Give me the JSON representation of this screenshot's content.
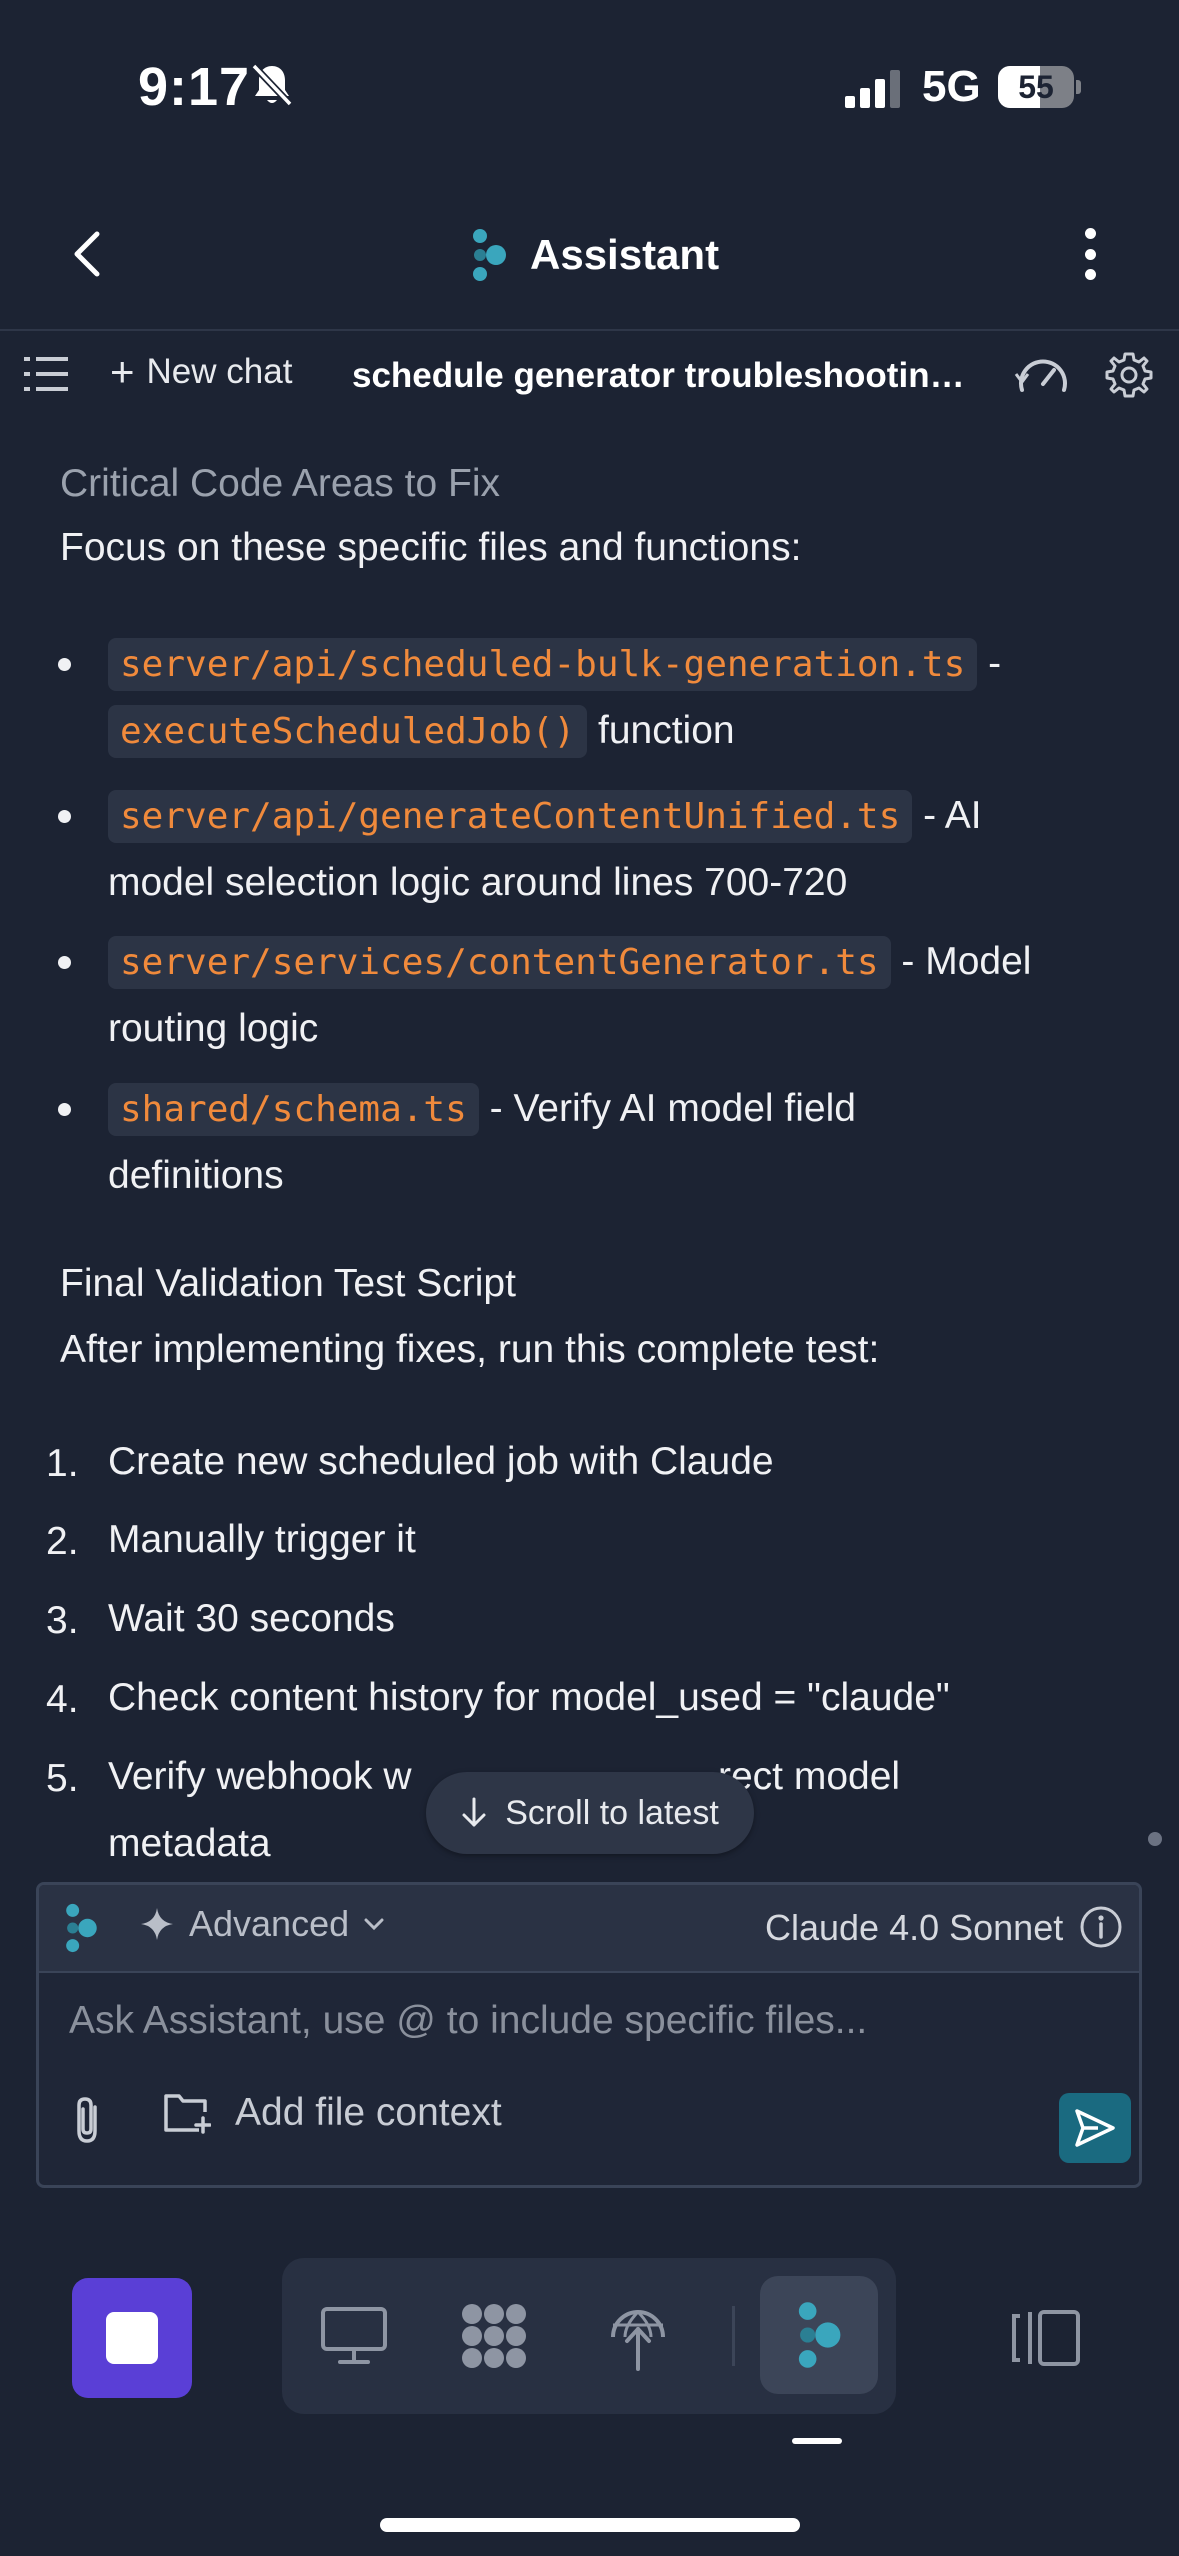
{
  "status_bar": {
    "time": "9:17",
    "network": "5G",
    "battery_percent": "55",
    "battery_level": 0.55
  },
  "header": {
    "title": "Assistant"
  },
  "toolbar": {
    "new_chat_label": "New chat",
    "chat_title": "schedule generator troubleshooting ..."
  },
  "content": {
    "section1_heading": "Critical Code Areas to Fix",
    "section1_intro": "Focus on these specific files and functions:",
    "bullets": [
      {
        "code": "server/api/scheduled-bulk-generation.ts",
        "text_after": " -",
        "code2": "executeScheduledJob()",
        "text2": " function"
      },
      {
        "code": "server/api/generateContentUnified.ts",
        "text_after": " - AI",
        "line2": "model selection logic around lines 700-720"
      },
      {
        "code": "server/services/contentGenerator.ts",
        "text_after": " - Model",
        "line2": "routing logic"
      },
      {
        "code": "shared/schema.ts",
        "text_after": " - Verify AI model field",
        "line2": "definitions"
      }
    ],
    "section2_heading": "Final Validation Test Script",
    "section2_intro": "After implementing fixes, run this complete test:",
    "steps": [
      {
        "num": "1.",
        "text": "Create new scheduled job with Claude"
      },
      {
        "num": "2.",
        "text": "Manually trigger it"
      },
      {
        "num": "3.",
        "text": "Wait 30 seconds"
      },
      {
        "num": "4.",
        "text": "Check content history for model_used = \"claude\""
      },
      {
        "num": "5.",
        "text": "Verify webhook w",
        "text_hidden_right": "rect model",
        "line2": "metadata"
      }
    ]
  },
  "scroll_to_latest_label": "Scroll to latest",
  "input_panel": {
    "mode_label": "Advanced",
    "model_label": "Claude 4.0 Sonnet",
    "placeholder": "Ask Assistant, use @ to include specific files...",
    "add_context_label": "Add file context"
  },
  "colors": {
    "background": "#1c2333",
    "code_text": "#f08a3c",
    "accent_stop": "#5a3fd6",
    "send_button": "#1a6a80"
  }
}
